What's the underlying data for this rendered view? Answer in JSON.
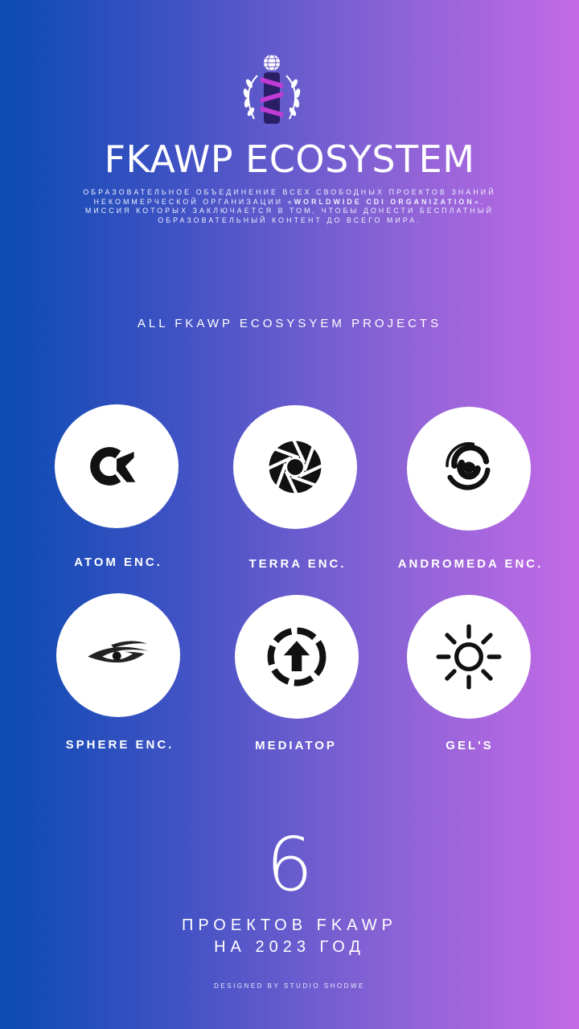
{
  "header": {
    "title": "FKAWP ECOSYSTEM",
    "description_pre": "Образовательное объединение всех свободных проектов знаний некоммерческой организации «",
    "description_bold": "Worldwide CDI Organization",
    "description_post": "». Миссия которых заключается в том, чтобы донести бесплатный образовательный контент до всего мира."
  },
  "section_title": "ALL FKAWP ECOSYSYEM PROJECTS",
  "projects": [
    {
      "label": "ATOM ENC.",
      "icon": "alpha-icon"
    },
    {
      "label": "TERRA ENC.",
      "icon": "aperture-icon"
    },
    {
      "label": "ANDROMEDA ENC.",
      "icon": "galaxy-spiral-icon"
    },
    {
      "label": "SPHERE ENC.",
      "icon": "eye-icon"
    },
    {
      "label": "MEDIATOP",
      "icon": "upload-circle-icon"
    },
    {
      "label": "GEL'S",
      "icon": "sun-icon"
    }
  ],
  "summary": {
    "count": "6",
    "label_line1": "ПРОЕКТОВ FKAWP",
    "label_line2": "НА 2023 ГОД"
  },
  "footer": "DESIGNED BY STUDIO SHODWE",
  "colors": {
    "gradient_start": "#0a4bb2",
    "gradient_end": "#c46ae6",
    "circle": "#ffffff",
    "icon": "#111111",
    "logo_ribbon": "#c13bd6"
  }
}
